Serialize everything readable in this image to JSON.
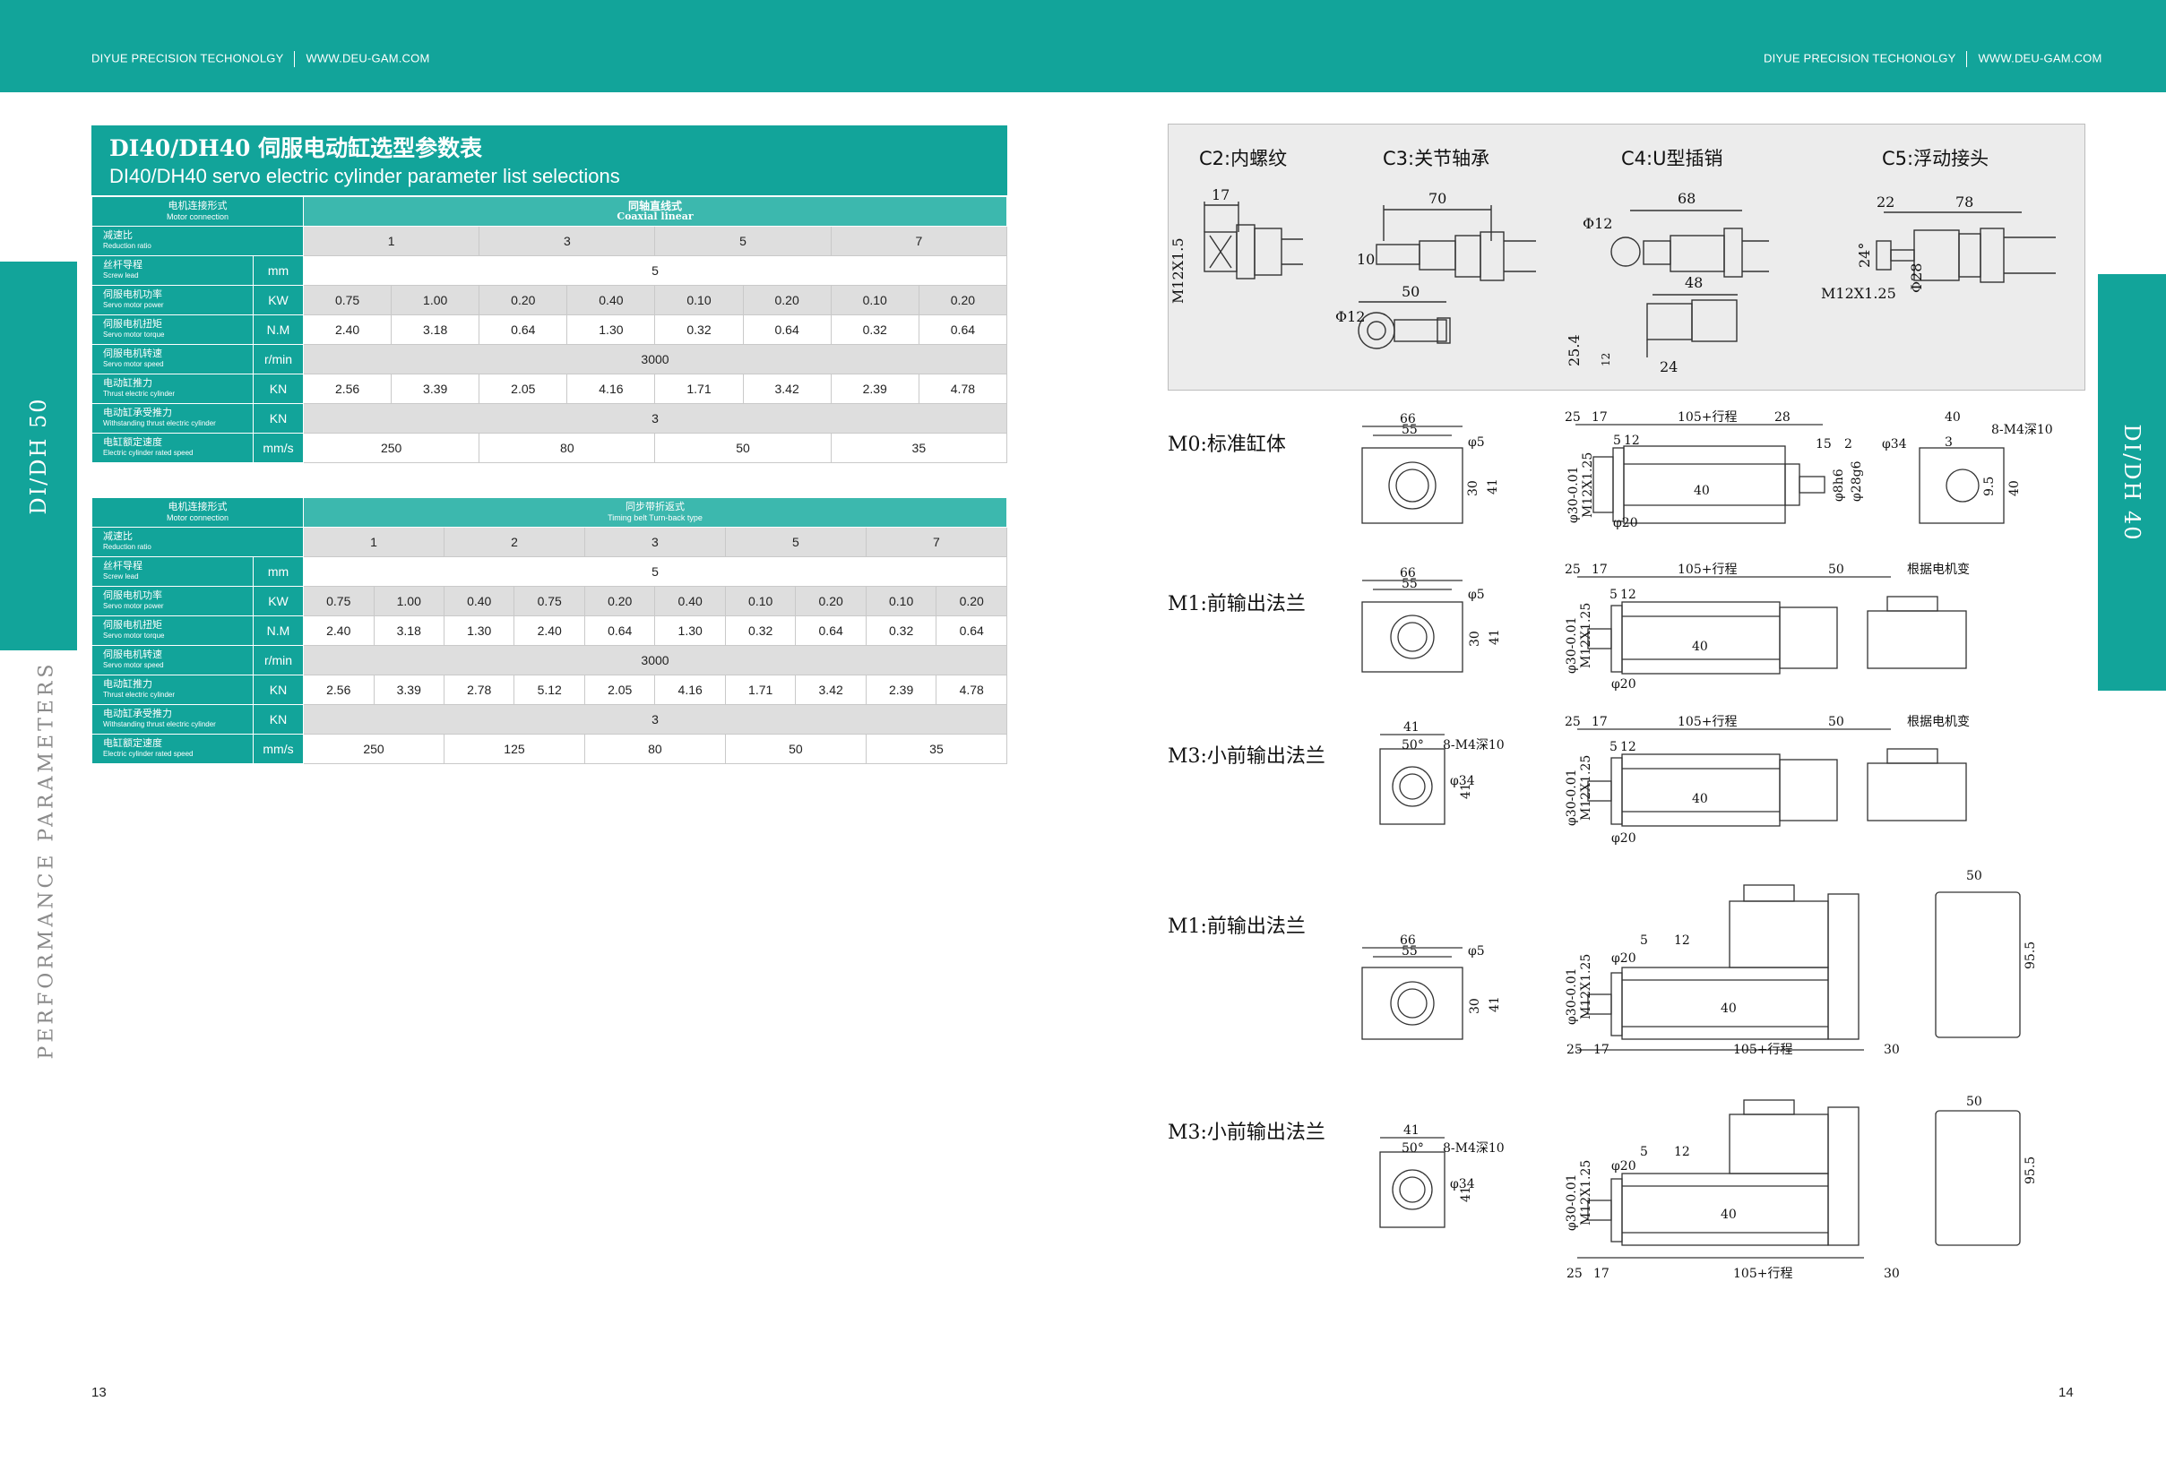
{
  "header": {
    "company": "DIYUE PRECISION TECHONOLGY",
    "website": "WWW.DEU-GAM.COM"
  },
  "side_tabs": {
    "left": "DI/DH 50",
    "right": "DI/DH 40",
    "left_sub": "PERFORMANCE PARAMETERS"
  },
  "title": {
    "zh": "DI40/DH40 伺服电动缸选型参数表",
    "en": "DI40/DH40 servo electric cylinder parameter list selections"
  },
  "rows": {
    "motor_connection": {
      "zh": "电机连接形式",
      "en": "Motor connection"
    },
    "reduction": {
      "zh": "减速比",
      "en": "Reduction ratio"
    },
    "lead": {
      "zh": "丝杆导程",
      "en": "Screw lead",
      "unit": "mm"
    },
    "power": {
      "zh": "伺服电机功率",
      "en": "Servo motor power",
      "unit": "KW"
    },
    "torque": {
      "zh": "伺服电机扭矩",
      "en": "Servo motor torque",
      "unit": "N.M"
    },
    "speed": {
      "zh": "伺服电机转速",
      "en": "Servo motor speed",
      "unit": "r/min"
    },
    "thrust": {
      "zh": "电动缸推力",
      "en": "Thrust electric cylinder",
      "unit": "KN"
    },
    "withstand": {
      "zh": "电动缸承受推力",
      "en": "Withstanding thrust electric cylinder",
      "unit": "KN"
    },
    "rated_speed": {
      "zh": "电缸额定速度",
      "en": "Electric cylinder rated speed",
      "unit": "mm/s"
    }
  },
  "table1": {
    "connection": {
      "zh": "同轴直线式",
      "en": "Coaxial linear"
    },
    "ratios": [
      "1",
      "3",
      "5",
      "7"
    ],
    "lead": "5",
    "power": [
      "0.75",
      "1.00",
      "0.20",
      "0.40",
      "0.10",
      "0.20",
      "0.10",
      "0.20"
    ],
    "torque": [
      "2.40",
      "3.18",
      "0.64",
      "1.30",
      "0.32",
      "0.64",
      "0.32",
      "0.64"
    ],
    "speed": "3000",
    "thrust": [
      "2.56",
      "3.39",
      "2.05",
      "4.16",
      "1.71",
      "3.42",
      "2.39",
      "4.78"
    ],
    "withstand": "3",
    "rated_speed": [
      "250",
      "80",
      "50",
      "35"
    ]
  },
  "table2": {
    "connection": {
      "zh": "同步带折返式",
      "en": "Timing belt Turn-back type"
    },
    "ratios": [
      "1",
      "2",
      "3",
      "5",
      "7"
    ],
    "lead": "5",
    "power": [
      "0.75",
      "1.00",
      "0.40",
      "0.75",
      "0.20",
      "0.40",
      "0.10",
      "0.20",
      "0.10",
      "0.20"
    ],
    "torque": [
      "2.40",
      "3.18",
      "1.30",
      "2.40",
      "0.64",
      "1.30",
      "0.32",
      "0.64",
      "0.32",
      "0.64"
    ],
    "speed": "3000",
    "thrust": [
      "2.56",
      "3.39",
      "2.78",
      "5.12",
      "2.05",
      "4.16",
      "1.71",
      "3.42",
      "2.39",
      "4.78"
    ],
    "withstand": "3",
    "rated_speed": [
      "250",
      "125",
      "80",
      "50",
      "35"
    ]
  },
  "couplings": {
    "c2": "C2:内螺纹",
    "c3": "C3:关节轴承",
    "c4": "C4:U型插销",
    "c5": "C5:浮动接头",
    "dims": {
      "c2_len": "17",
      "c2_thread": "M12X1.5",
      "c3_len": "70",
      "c3_h": "10",
      "c3_dia": "Φ12",
      "c3_b": "50",
      "c4_dia": "Φ12",
      "c4_len": "68",
      "c4_b": "48",
      "c4_h": "25.4",
      "c4_w": "24",
      "c4_tol": "12",
      "c5_a": "22",
      "c5_b": "78",
      "c5_angle": "24°",
      "c5_dia": "Φ28",
      "c5_thread": "M12X1.25"
    }
  },
  "models": {
    "m0": "M0:标准缸体",
    "m1a": "M1:前输出法兰",
    "m3a": "M3:小前输出法兰",
    "m1b": "M1:前输出法兰",
    "m3b": "M3:小前输出法兰"
  },
  "dims": {
    "w66": "66",
    "w55": "55",
    "phi5": "φ5",
    "h30": "30",
    "h41": "41",
    "w41": "41",
    "d25": "25",
    "d17": "17",
    "stroke": "105+行程",
    "d28": "28",
    "d15": "15",
    "d2": "2",
    "d5": "5",
    "d12": "12",
    "phi20": "φ20",
    "phi30": "φ30-0.01",
    "m12": "M12X1.25",
    "phi8": "φ8h6",
    "phi28": "φ28g6",
    "phi34": "φ34",
    "d3": "3",
    "d9": "9.5",
    "d40": "40",
    "m4": "8-M4深10",
    "d50": "50",
    "by_motor": "根据电机变",
    "ang50": "50°",
    "d30": "30",
    "d95": "95.5"
  },
  "pages": {
    "left": "13",
    "right": "14"
  }
}
